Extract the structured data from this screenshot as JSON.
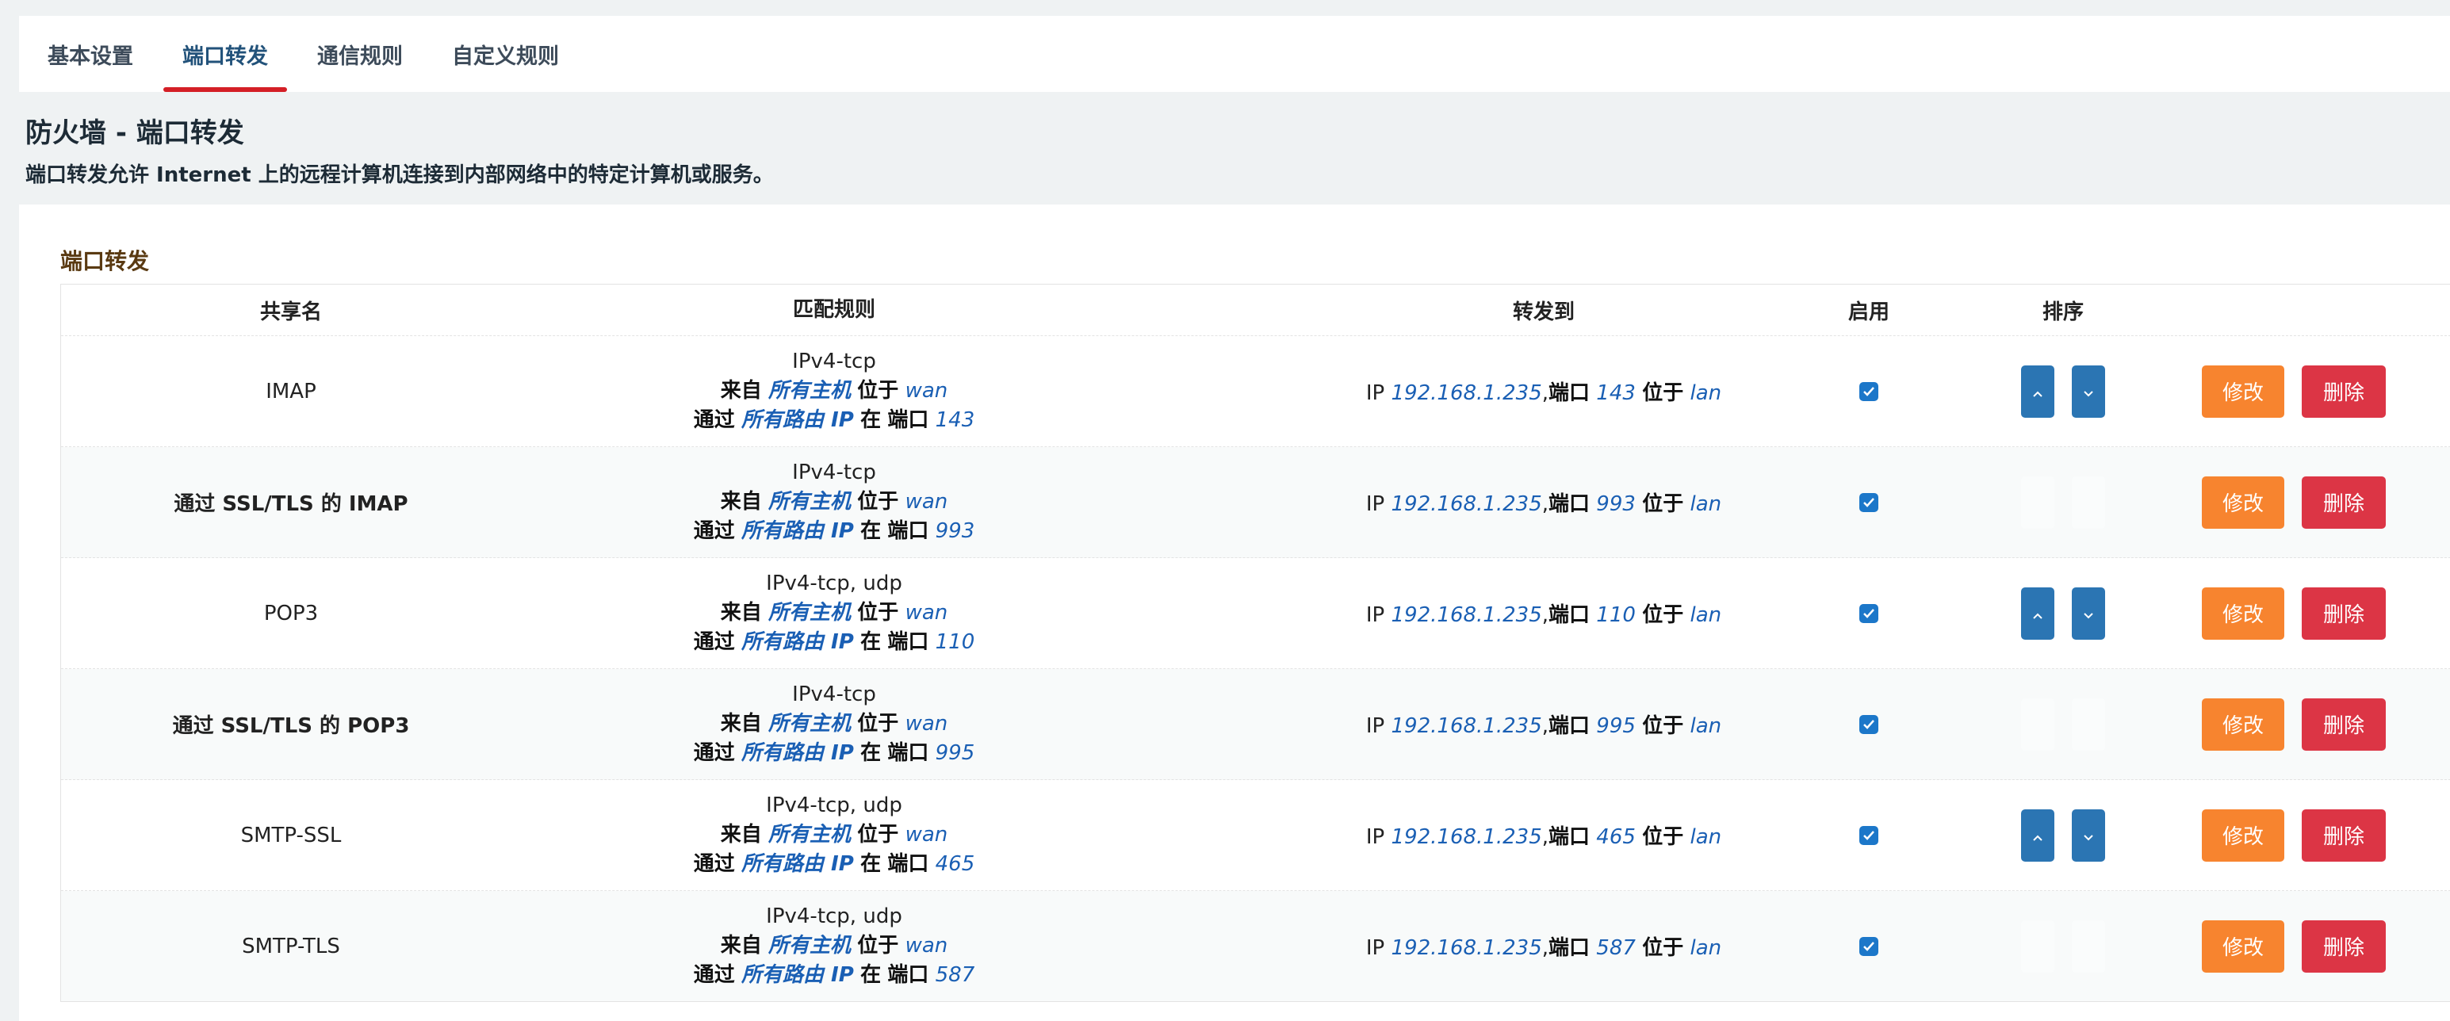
{
  "tabs": [
    {
      "label": "基本设置",
      "active": false
    },
    {
      "label": "端口转发",
      "active": true
    },
    {
      "label": "通信规则",
      "active": false
    },
    {
      "label": "自定义规则",
      "active": false
    }
  ],
  "page": {
    "title": "防火墙 - 端口转发",
    "description": "端口转发允许 Internet 上的远程计算机连接到内部网络中的特定计算机或服务。"
  },
  "section": {
    "title": "端口转发",
    "columns": [
      "共享名",
      "匹配规则",
      "转发到",
      "启用",
      "排序"
    ]
  },
  "labels": {
    "from": "来自",
    "located": "位于",
    "via": "通过",
    "at": "在",
    "port": "端口",
    "ip": "IP",
    "comma": ",",
    "edit": "修改",
    "delete": "删除"
  },
  "rows": [
    {
      "name": "IMAP",
      "proto": "IPv4-tcp",
      "src_host": "所有主机",
      "src_zone": "wan",
      "via_ip": "所有路由 IP",
      "ext_port": "143",
      "dest_ip": "192.168.1.235",
      "dest_port": "143",
      "dest_zone": "lan",
      "enabled": true,
      "sortable": true
    },
    {
      "name": "通过 SSL/TLS 的 IMAP",
      "proto": "IPv4-tcp",
      "src_host": "所有主机",
      "src_zone": "wan",
      "via_ip": "所有路由 IP",
      "ext_port": "993",
      "dest_ip": "192.168.1.235",
      "dest_port": "993",
      "dest_zone": "lan",
      "enabled": true,
      "sortable": false
    },
    {
      "name": "POP3",
      "proto": "IPv4-tcp, udp",
      "src_host": "所有主机",
      "src_zone": "wan",
      "via_ip": "所有路由 IP",
      "ext_port": "110",
      "dest_ip": "192.168.1.235",
      "dest_port": "110",
      "dest_zone": "lan",
      "enabled": true,
      "sortable": true
    },
    {
      "name": "通过 SSL/TLS 的 POP3",
      "proto": "IPv4-tcp",
      "src_host": "所有主机",
      "src_zone": "wan",
      "via_ip": "所有路由 IP",
      "ext_port": "995",
      "dest_ip": "192.168.1.235",
      "dest_port": "995",
      "dest_zone": "lan",
      "enabled": true,
      "sortable": false
    },
    {
      "name": "SMTP-SSL",
      "proto": "IPv4-tcp, udp",
      "src_host": "所有主机",
      "src_zone": "wan",
      "via_ip": "所有路由 IP",
      "ext_port": "465",
      "dest_ip": "192.168.1.235",
      "dest_port": "465",
      "dest_zone": "lan",
      "enabled": true,
      "sortable": true
    },
    {
      "name": "SMTP-TLS",
      "proto": "IPv4-tcp, udp",
      "src_host": "所有主机",
      "src_zone": "wan",
      "via_ip": "所有路由 IP",
      "ext_port": "587",
      "dest_ip": "192.168.1.235",
      "dest_port": "587",
      "dest_zone": "lan",
      "enabled": true,
      "sortable": false
    }
  ]
}
